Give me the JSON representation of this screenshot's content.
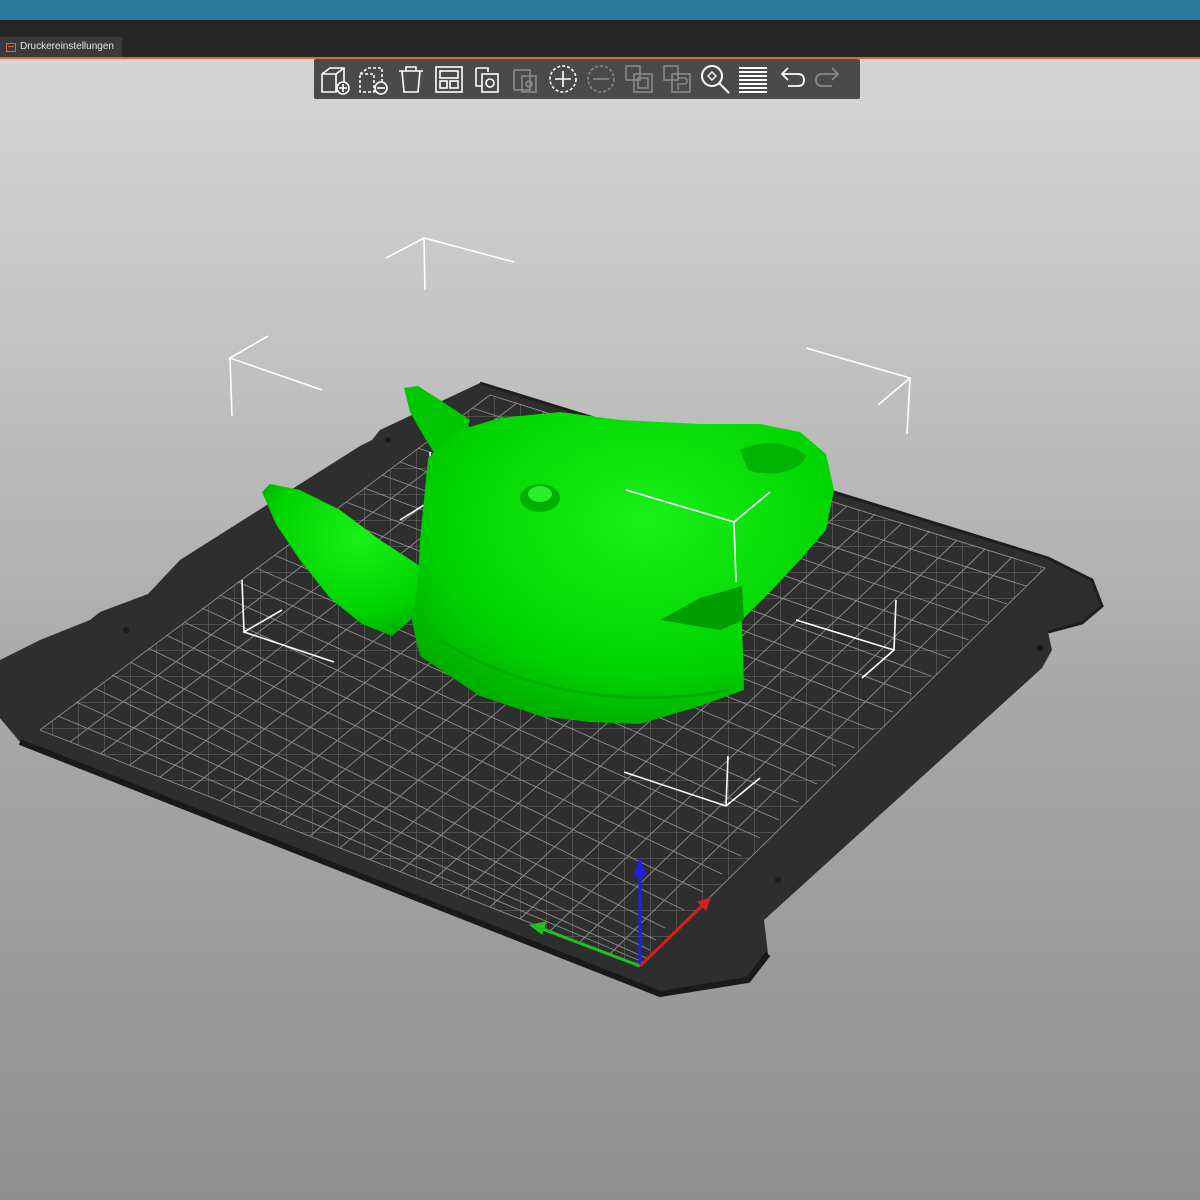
{
  "window": {
    "tab_label": "Druckereinstellungen"
  },
  "toolbar": {
    "buttons": [
      {
        "name": "add-object",
        "icon": "add-cube-icon",
        "enabled": true
      },
      {
        "name": "delete-object",
        "icon": "remove-cube-icon",
        "enabled": true
      },
      {
        "name": "delete-all",
        "icon": "trash-icon",
        "enabled": true
      },
      {
        "name": "arrange",
        "icon": "arrange-icon",
        "enabled": true
      },
      {
        "name": "copy",
        "icon": "copy-icon",
        "enabled": true
      },
      {
        "name": "paste",
        "icon": "paste-icon",
        "enabled": false
      },
      {
        "name": "add-instance",
        "icon": "plus-circle-icon",
        "enabled": true
      },
      {
        "name": "remove-instance",
        "icon": "minus-circle-icon",
        "enabled": false
      },
      {
        "name": "split-objects",
        "icon": "split-objects-icon",
        "enabled": false
      },
      {
        "name": "split-parts",
        "icon": "split-parts-icon",
        "enabled": false
      },
      {
        "name": "search",
        "icon": "search-icon",
        "enabled": true
      },
      {
        "name": "layers",
        "icon": "layers-icon",
        "enabled": true
      },
      {
        "name": "undo",
        "icon": "undo-icon",
        "enabled": true
      },
      {
        "name": "redo",
        "icon": "redo-icon",
        "enabled": false
      }
    ]
  },
  "scene": {
    "model_color": "#00e000",
    "bed_color": "#2e2e2e",
    "axis_colors": {
      "x": "#d02020",
      "y": "#20c020",
      "z": "#2020e0"
    }
  }
}
